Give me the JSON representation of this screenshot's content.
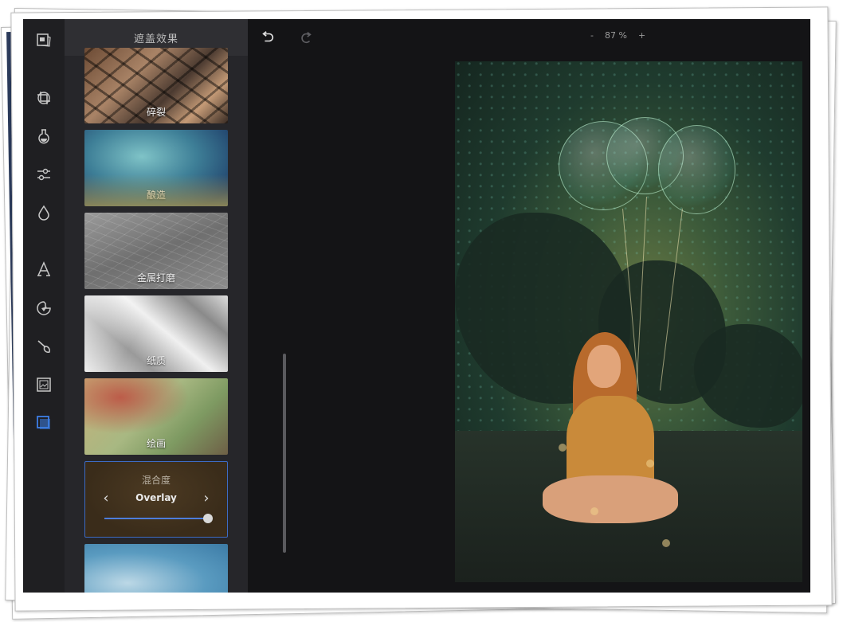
{
  "panel": {
    "header_title": "遮盖效果",
    "items": [
      {
        "label": "碎裂"
      },
      {
        "label": "酿造"
      },
      {
        "label": "金属打磨"
      },
      {
        "label": "纸质"
      },
      {
        "label": "绘画"
      }
    ],
    "blend": {
      "title": "混合度",
      "mode": "Overlay",
      "prev_icon": "‹",
      "next_icon": "›",
      "slider_value": 1.0
    }
  },
  "toolbar": {
    "undo_icon": "undo-icon",
    "redo_icon": "redo-icon",
    "zoom_minus": "-",
    "zoom_value": "87 %",
    "zoom_plus": "+"
  },
  "rail": {
    "tools": [
      "image-info-icon",
      "crop-icon",
      "filter-icon",
      "adjust-icon",
      "drop-icon",
      "text-icon",
      "sticker-icon",
      "brush-icon",
      "frame-icon",
      "overlay-icon"
    ],
    "active_tool": "overlay-icon",
    "accent_color": "#3d7ee6"
  }
}
